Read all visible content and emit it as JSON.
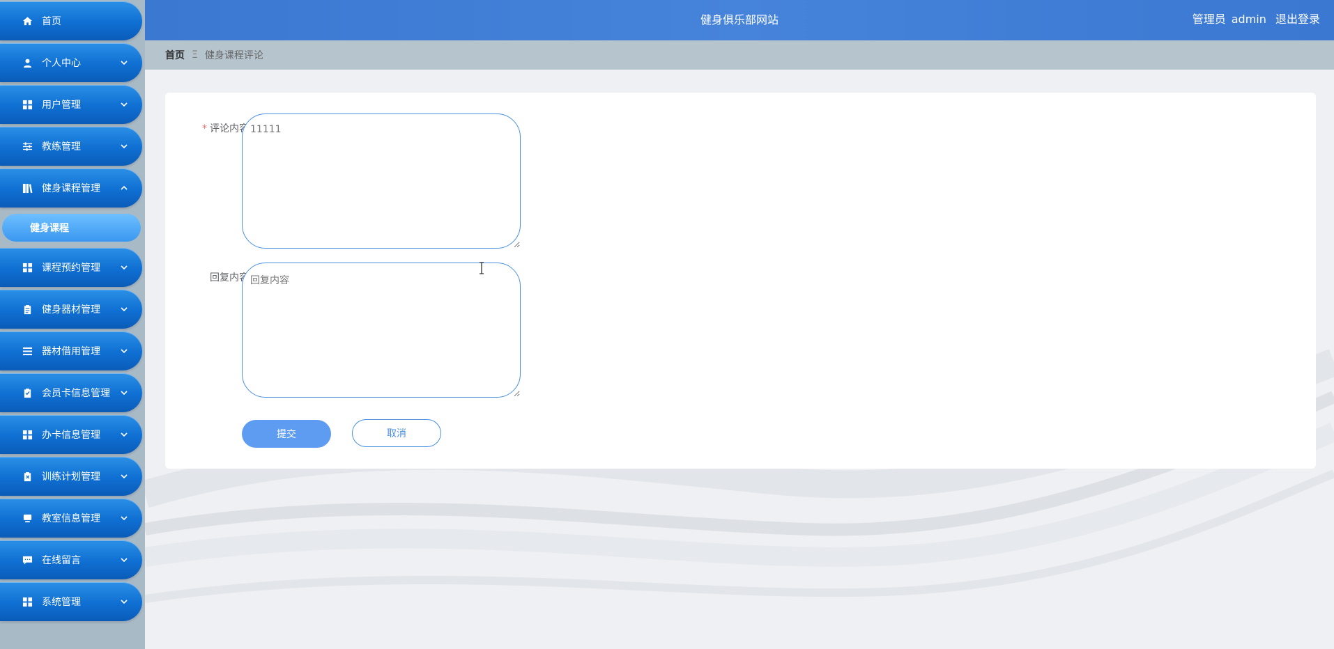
{
  "header": {
    "site_title": "健身俱乐部网站",
    "role": "管理员",
    "username": "admin",
    "logout": "退出登录"
  },
  "breadcrumb": {
    "home": "首页",
    "separator": "Ξ",
    "current": "健身课程评论"
  },
  "sidebar": {
    "items": [
      {
        "label": "首页",
        "icon": "home-icon",
        "expandable": false
      },
      {
        "label": "个人中心",
        "icon": "user-icon",
        "expandable": true
      },
      {
        "label": "用户管理",
        "icon": "grid-icon",
        "expandable": true
      },
      {
        "label": "教练管理",
        "icon": "sliders-icon",
        "expandable": true
      },
      {
        "label": "健身课程管理",
        "icon": "book-icon",
        "expandable": true,
        "expanded": true
      },
      {
        "label": "课程预约管理",
        "icon": "grid-icon",
        "expandable": true
      },
      {
        "label": "健身器材管理",
        "icon": "clipboard-icon",
        "expandable": true
      },
      {
        "label": "器材借用管理",
        "icon": "list-icon",
        "expandable": true
      },
      {
        "label": "会员卡信息管理",
        "icon": "clipboard-check-icon",
        "expandable": true
      },
      {
        "label": "办卡信息管理",
        "icon": "grid-icon",
        "expandable": true
      },
      {
        "label": "训练计划管理",
        "icon": "clipboard-x-icon",
        "expandable": true
      },
      {
        "label": "教室信息管理",
        "icon": "monitor-icon",
        "expandable": true
      },
      {
        "label": "在线留言",
        "icon": "chat-icon",
        "expandable": true
      },
      {
        "label": "系统管理",
        "icon": "grid-icon",
        "expandable": true
      }
    ],
    "active_sub": "健身课程"
  },
  "form": {
    "comment_label": "评论内容",
    "comment_required": "*",
    "comment_placeholder": "11111",
    "reply_label": "回复内容",
    "reply_placeholder": "回复内容",
    "submit_label": "提交",
    "cancel_label": "取消"
  },
  "colors": {
    "header": "#4683da",
    "nav": "#0f6fd2",
    "nav_active": "#3a98f0",
    "primary_button": "#5d9cf1"
  }
}
